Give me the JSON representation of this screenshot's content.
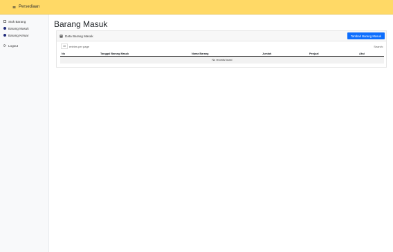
{
  "app": {
    "brand": "Persediaan"
  },
  "sidebar": {
    "items": [
      {
        "label": "Stok Barang",
        "icon": "box-icon"
      },
      {
        "label": "Barang Masuk",
        "icon": "circle-icon"
      },
      {
        "label": "Barang Keluar",
        "icon": "circle-icon"
      },
      {
        "label": "Logout",
        "icon": "logout-icon"
      }
    ]
  },
  "main": {
    "title": "Barang Masuk",
    "card": {
      "title": "Data Barang Masuk",
      "button": "Tambah Barang Masuk"
    },
    "toolbar": {
      "entries_value": "10",
      "entries_text": "entries per page",
      "search_label": "Search:"
    },
    "table": {
      "columns": [
        "No",
        "Tanggal Barang Masuk",
        "Nama Barang",
        "Jumlah",
        "Penjual",
        "Aksi"
      ],
      "empty_text": "No records found"
    }
  },
  "colors": {
    "topbar": "#ffd966",
    "primary": "#0d6efd",
    "sidebar_bullet": "#1f2a7a"
  }
}
